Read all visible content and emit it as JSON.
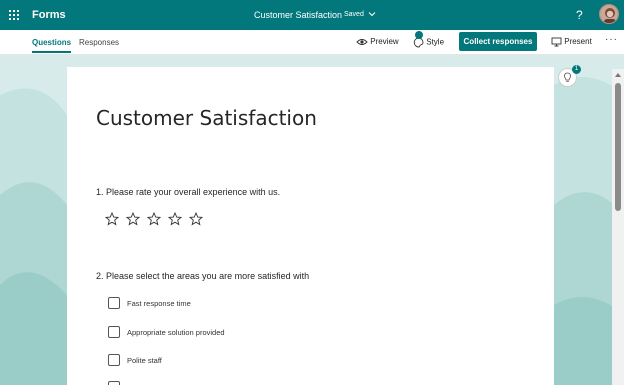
{
  "topbar": {
    "app_name": "Forms",
    "doc_title": "Customer Satisfaction",
    "save_status": "Saved",
    "help": "?"
  },
  "command_bar": {
    "tabs": [
      {
        "label": "Questions",
        "selected": true
      },
      {
        "label": "Responses",
        "selected": false
      }
    ],
    "preview_label": "Preview",
    "style_label": "Style",
    "collect_label": "Collect responses",
    "present_label": "Present",
    "more": "···"
  },
  "form": {
    "title": "Customer Satisfaction",
    "questions": [
      {
        "text": "1. Please rate your overall experience with us.",
        "type": "rating",
        "max_stars": 5
      },
      {
        "text": "2. Please select the areas you are more satisfied with",
        "type": "checkbox",
        "options": [
          "Fast response time",
          "Appropriate solution provided",
          "Polite staff"
        ]
      }
    ]
  },
  "side_panel": {
    "badge_count": "1"
  },
  "colors": {
    "accent": "#03787c",
    "background": "#dff0ef"
  }
}
